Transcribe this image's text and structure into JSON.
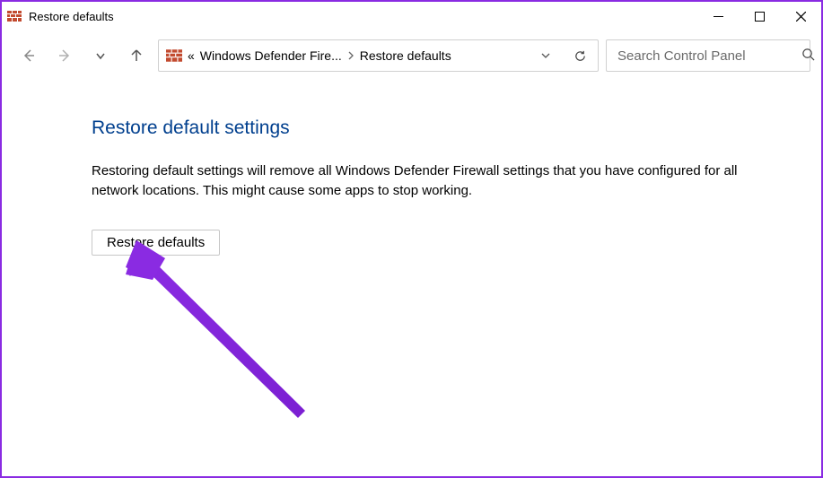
{
  "window": {
    "title": "Restore defaults"
  },
  "toolbar": {
    "breadcrumb_prefix": "«",
    "breadcrumb_parent": "Windows Defender Fire...",
    "breadcrumb_current": "Restore defaults",
    "search_placeholder": "Search Control Panel"
  },
  "main": {
    "heading": "Restore default settings",
    "body": "Restoring default settings will remove all Windows Defender Firewall settings that you have configured for all network locations. This might cause some apps to stop working.",
    "button_label": "Restore defaults"
  }
}
